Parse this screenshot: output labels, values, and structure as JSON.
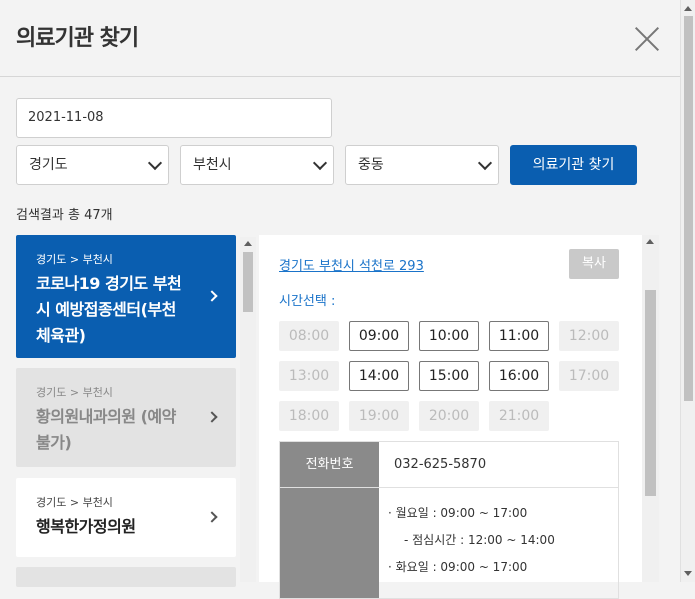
{
  "header": {
    "title": "의료기관 찾기"
  },
  "search": {
    "date": "2021-11-08",
    "province": "경기도",
    "city": "부천시",
    "district": "중동",
    "button_label": "의료기관 찾기"
  },
  "result_count_text": "검색결과 총 47개",
  "clinics": [
    {
      "region": "경기도 > 부천시",
      "name_line1": "코로나19 경기도 부천",
      "name_line2": "시 예방접종센터(부천",
      "name_line3": "체육관)",
      "state": "selected"
    },
    {
      "region": "경기도 > 부천시",
      "name_line1": "황의원내과의원 (예약",
      "name_line2": "불가)",
      "state": "unavailable"
    },
    {
      "region": "경기도 > 부천시",
      "name_line1": "행복한가정의원",
      "state": "available"
    }
  ],
  "detail": {
    "address": "경기도 부천시 석천로 293",
    "copy_label": "복사",
    "time_select_label": "시간선택 :",
    "time_slots": [
      {
        "time": "08:00",
        "available": false
      },
      {
        "time": "09:00",
        "available": true
      },
      {
        "time": "10:00",
        "available": true
      },
      {
        "time": "11:00",
        "available": true
      },
      {
        "time": "12:00",
        "available": false
      },
      {
        "time": "13:00",
        "available": false
      },
      {
        "time": "14:00",
        "available": true
      },
      {
        "time": "15:00",
        "available": true
      },
      {
        "time": "16:00",
        "available": true
      },
      {
        "time": "17:00",
        "available": false
      },
      {
        "time": "18:00",
        "available": false
      },
      {
        "time": "19:00",
        "available": false
      },
      {
        "time": "20:00",
        "available": false
      },
      {
        "time": "21:00",
        "available": false
      }
    ],
    "phone_label": "전화번호",
    "phone": "032-625-5870",
    "hours": [
      "· 월요일 : 09:00 ~ 17:00",
      "- 점심시간 : 12:00 ~ 14:00",
      "· 화요일 : 09:00 ~ 17:00"
    ]
  },
  "colors": {
    "primary": "#0a5eb0",
    "link": "#1a73c9"
  }
}
